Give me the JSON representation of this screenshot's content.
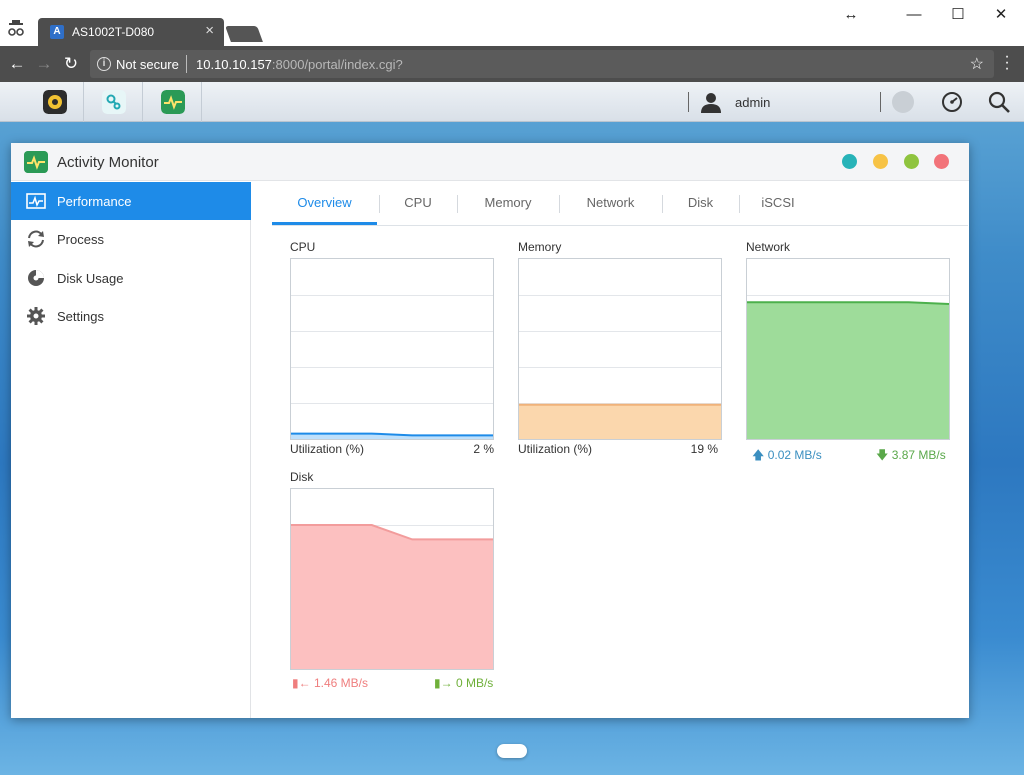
{
  "browser": {
    "tab_title": "AS1002T-D080",
    "tab_close": "×",
    "security_label": "Not secure",
    "url_host": "10.10.10.157",
    "url_rest": ":8000/portal/index.cgi?",
    "window_controls": [
      "↔",
      "—",
      "☐",
      "✕"
    ]
  },
  "taskbar": {
    "username": "admin",
    "apps": [
      "settings-app-icon",
      "connection-app-icon",
      "activity-monitor-app-icon"
    ]
  },
  "window": {
    "title": "Activity Monitor",
    "control_colors": [
      "#27b3b8",
      "#f7c346",
      "#8fc43f",
      "#f2737a"
    ]
  },
  "sidebar": {
    "items": [
      {
        "label": "Performance",
        "icon": "performance-icon"
      },
      {
        "label": "Process",
        "icon": "process-icon"
      },
      {
        "label": "Disk Usage",
        "icon": "disk-usage-icon"
      },
      {
        "label": "Settings",
        "icon": "settings-gear-icon"
      }
    ]
  },
  "tabs": [
    "Overview",
    "CPU",
    "Memory",
    "Network",
    "Disk",
    "iSCSI"
  ],
  "panels": {
    "cpu": {
      "label": "CPU",
      "stat_label": "Utilization (%)",
      "stat_value": "2 %",
      "color": "#1e8be8"
    },
    "memory": {
      "label": "Memory",
      "stat_label": "Utilization (%)",
      "stat_value": "19 %",
      "color": "#f6c48d"
    },
    "network": {
      "label": "Network",
      "up": "0.02 MB/s",
      "down": "3.87 MB/s",
      "color": "#62c462"
    },
    "disk": {
      "label": "Disk",
      "read": "1.46 MB/s",
      "write": "0 MB/s",
      "color": "#f59a9a"
    }
  },
  "chart_data": [
    {
      "type": "area",
      "name": "CPU",
      "ylim": [
        0,
        100
      ],
      "values": [
        3,
        3,
        3,
        2,
        2,
        2
      ]
    },
    {
      "type": "area",
      "name": "Memory",
      "ylim": [
        0,
        100
      ],
      "values": [
        19,
        19,
        19,
        19,
        19,
        19
      ]
    },
    {
      "type": "area",
      "name": "Network",
      "ylim": [
        0,
        100
      ],
      "values": [
        76,
        76,
        76,
        76,
        76,
        75
      ]
    },
    {
      "type": "area",
      "name": "Disk",
      "ylim": [
        0,
        100
      ],
      "values": [
        80,
        80,
        80,
        72,
        72,
        72
      ]
    }
  ]
}
